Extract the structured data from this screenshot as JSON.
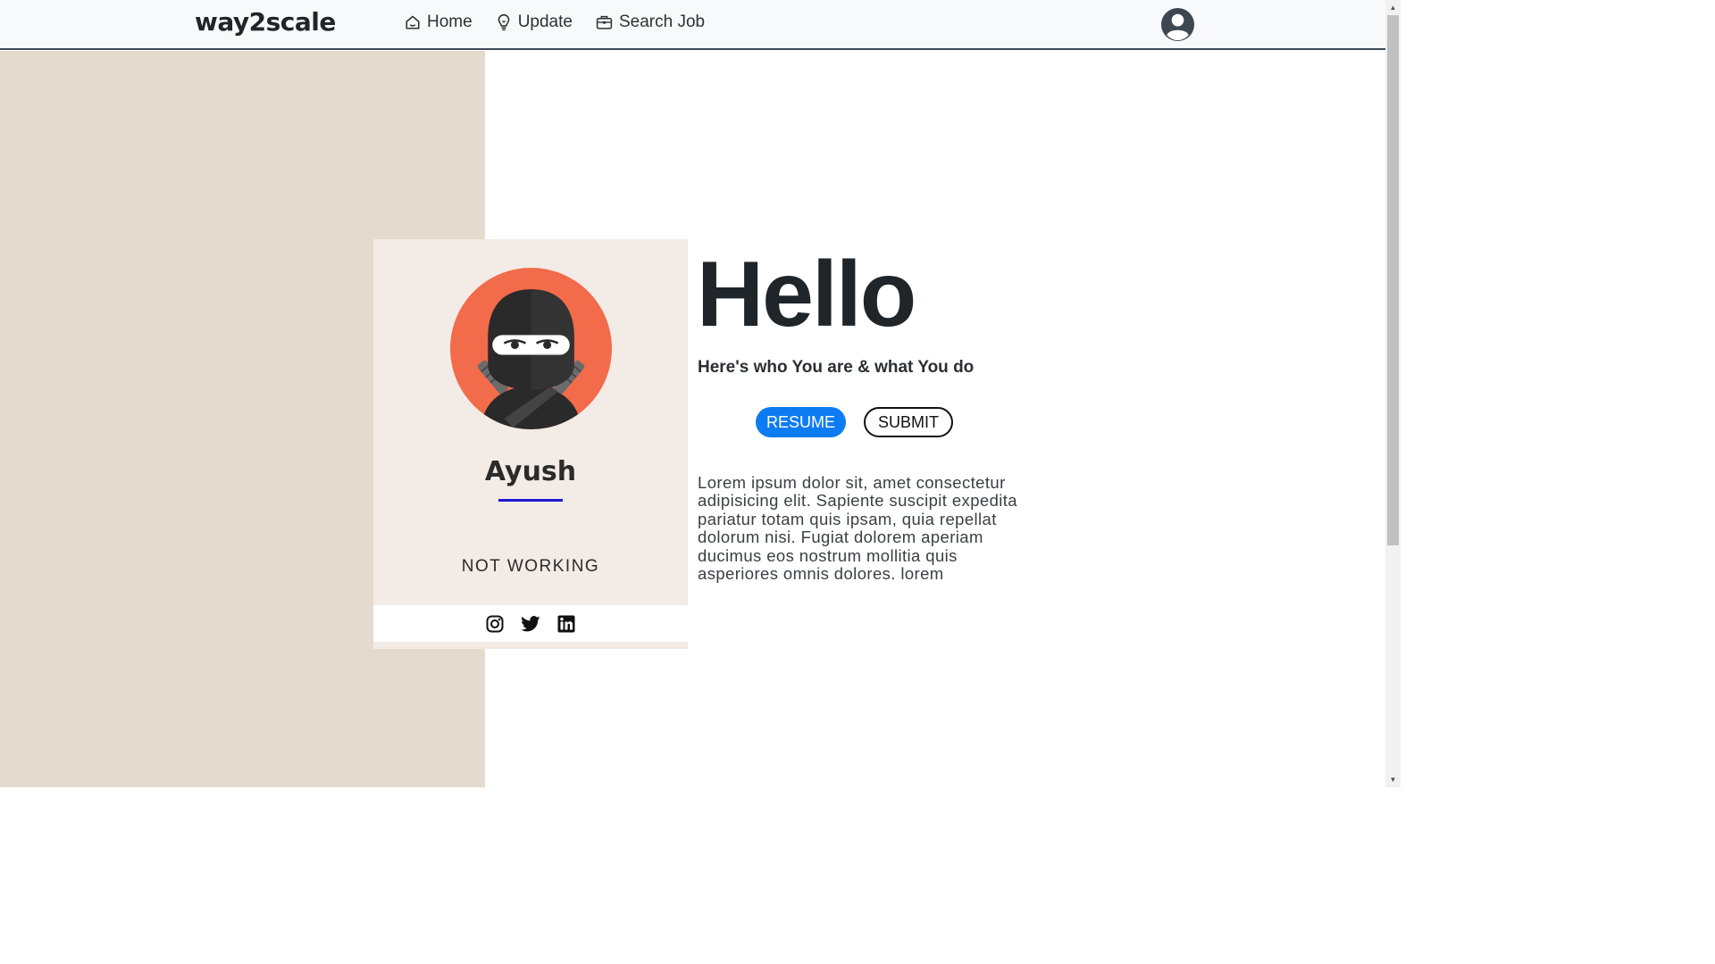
{
  "navbar": {
    "brand": "way2scale",
    "links": [
      {
        "label": "Home",
        "icon": "home-icon"
      },
      {
        "label": "Update",
        "icon": "lightbulb-icon"
      },
      {
        "label": "Search Job",
        "icon": "briefcase-icon"
      }
    ],
    "account_icon": "user-circle-icon"
  },
  "profile": {
    "name": "Ayush",
    "status": "NOT WORKING",
    "avatar": "ninja-avatar",
    "social": [
      {
        "icon": "instagram-icon"
      },
      {
        "icon": "twitter-icon"
      },
      {
        "icon": "linkedin-icon"
      }
    ]
  },
  "hero": {
    "heading": "Hello",
    "tagline": "Here's who You are & what You do",
    "resume_label": "RESUME",
    "submit_label": "SUBMIT",
    "description": "Lorem ipsum dolor sit, amet consectetur adipisicing elit. Sapiente suscipit expedita pariatur totam quis ipsam, quia repellat dolorum nisi. Fugiat dolorem aperiam ducimus eos nostrum mollitia quis asperiores omnis dolores. lorem"
  },
  "colors": {
    "left_panel": "#e5dace",
    "card": "#f3ebe5",
    "accent_blue": "#0d7cf2",
    "name_underline": "#1a1ad6",
    "avatar_bg": "#f26b4a"
  }
}
